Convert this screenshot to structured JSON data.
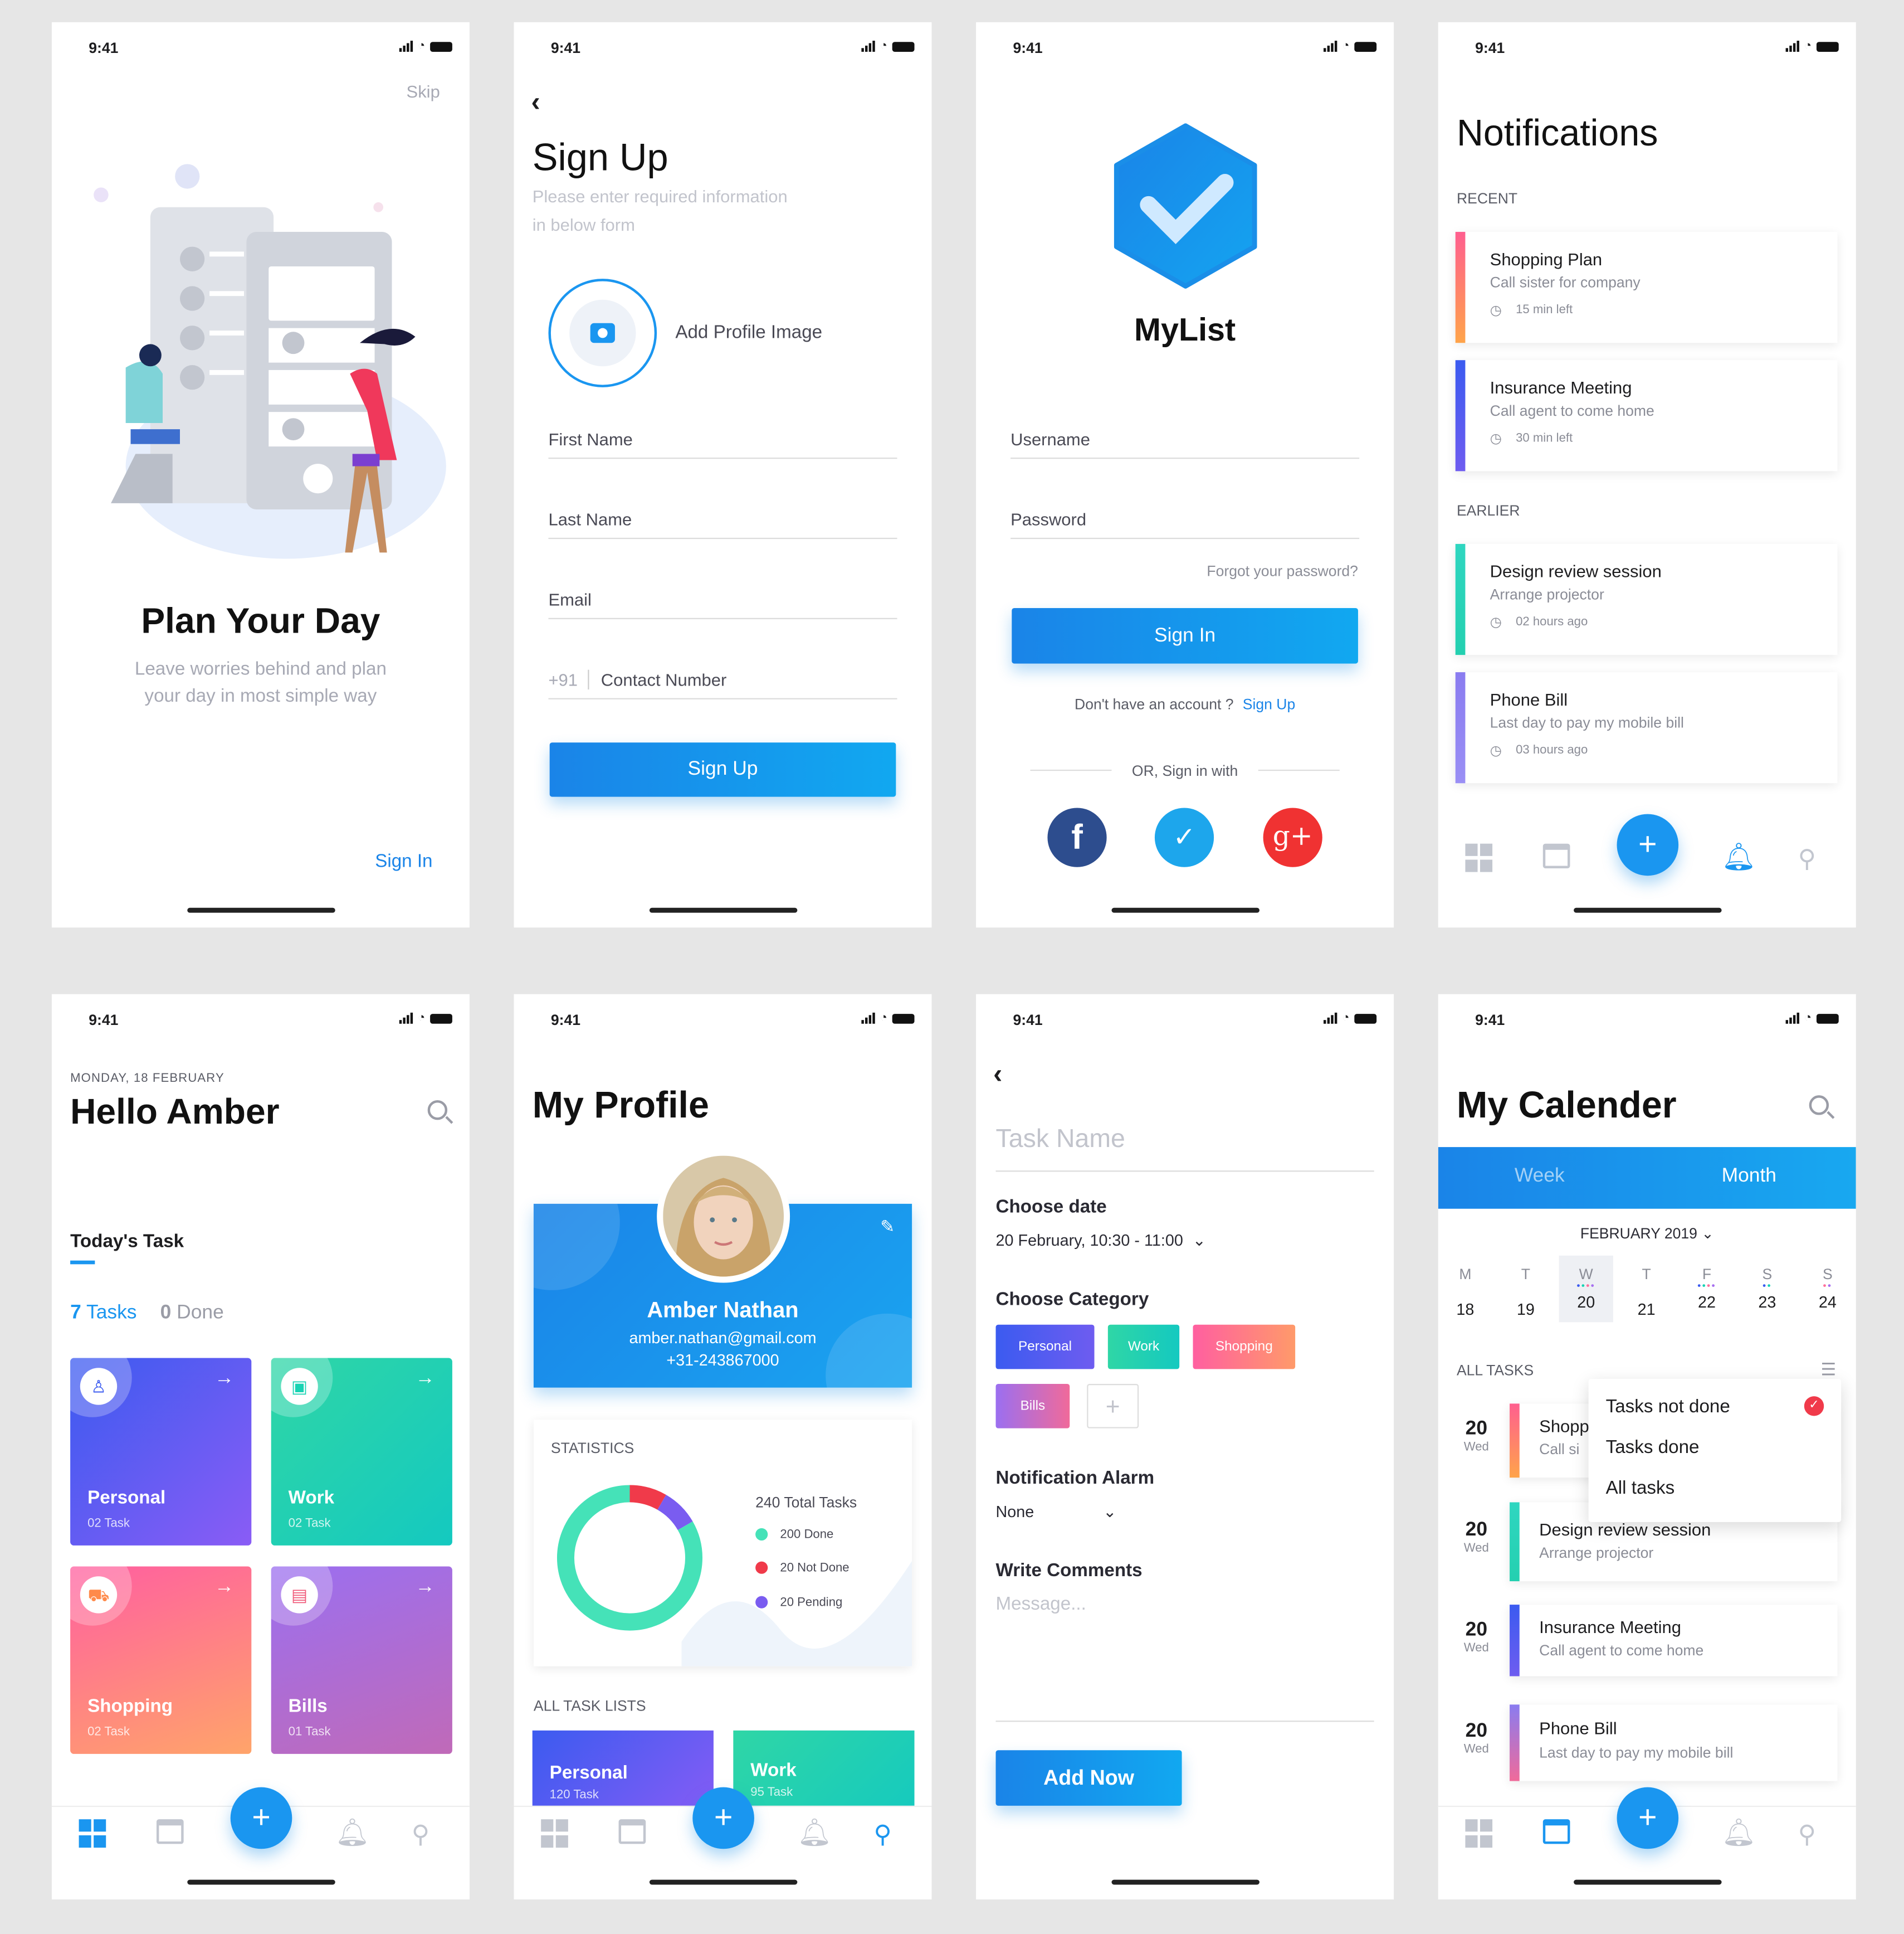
{
  "status": {
    "time": "9:41"
  },
  "onboard": {
    "skip": "Skip",
    "title": "Plan Your Day",
    "subtitle1": "Leave worries behind and plan",
    "subtitle2": "your day in most simple way",
    "signin": "Sign In"
  },
  "signup": {
    "title": "Sign Up",
    "sub1": "Please enter required information",
    "sub2": "in below form",
    "add_image": "Add Profile Image",
    "first_name": "First Name",
    "last_name": "Last Name",
    "email": "Email",
    "code": "+91",
    "contact": "Contact Number",
    "button": "Sign Up"
  },
  "login": {
    "app_name": "MyList",
    "username": "Username",
    "password": "Password",
    "forgot": "Forgot your password?",
    "button": "Sign In",
    "no_account": "Don't have an account ?",
    "signup_link": "Sign Up",
    "or": "OR, Sign in with"
  },
  "notifications": {
    "title": "Notifications",
    "recent": "RECENT",
    "earlier": "EARLIER",
    "items": [
      {
        "title": "Shopping Plan",
        "desc": "Call sister for company",
        "time": "15 min left",
        "color1": "#ff5f8f",
        "color2": "#ffa44a"
      },
      {
        "title": "Insurance Meeting",
        "desc": "Call agent to come home",
        "time": "30 min left",
        "color1": "#3b5bf0",
        "color2": "#6e5cf0"
      },
      {
        "title": "Design review session",
        "desc": "Arrange projector",
        "time": "02 hours ago",
        "color1": "#2fd6c0",
        "color2": "#24d0b0"
      },
      {
        "title": "Phone Bill",
        "desc": "Last day to pay my mobile bill",
        "time": "03 hours ago",
        "color1": "#8a7cf0",
        "color2": "#9a8ff5"
      }
    ]
  },
  "home": {
    "date": "MONDAY, 18 FEBRUARY",
    "greeting": "Hello Amber",
    "today": "Today's Task",
    "tasks_count": "7",
    "tasks_label": "Tasks",
    "done_count": "0",
    "done_label": "Done",
    "cats": [
      {
        "name": "Personal",
        "sub": "02 Task"
      },
      {
        "name": "Work",
        "sub": "02 Task"
      },
      {
        "name": "Shopping",
        "sub": "02 Task"
      },
      {
        "name": "Bills",
        "sub": "01 Task"
      }
    ]
  },
  "profile": {
    "title": "My Profile",
    "name": "Amber Nathan",
    "email": "amber.nathan@gmail.com",
    "phone": "+31-243867000",
    "stats": "STATISTICS",
    "total": "240 Total Tasks",
    "done": "200 Done",
    "not_done": "20 Not Done",
    "pending": "20 Pending",
    "lists": "ALL TASK LISTS",
    "l1": "Personal",
    "l1s": "120 Task",
    "l2": "Work",
    "l2s": "95 Task",
    "chart": {
      "done": 200,
      "not_done": 20,
      "pending": 20
    }
  },
  "addtask": {
    "placeholder": "Task Name",
    "choose_date": "Choose date",
    "date_value": "20 February, 10:30 - 11:00",
    "choose_cat": "Choose Category",
    "chips": [
      "Personal",
      "Work",
      "Shopping",
      "Bills"
    ],
    "alarm": "Notification Alarm",
    "alarm_value": "None",
    "comments": "Write Comments",
    "message": "Message...",
    "button": "Add Now"
  },
  "calendar": {
    "title": "My Calender",
    "week": "Week",
    "month": "Month",
    "month_label": "FEBRUARY 2019",
    "days": [
      {
        "l": "M",
        "n": "18"
      },
      {
        "l": "T",
        "n": "19"
      },
      {
        "l": "W",
        "n": "20"
      },
      {
        "l": "T",
        "n": "21"
      },
      {
        "l": "F",
        "n": "22"
      },
      {
        "l": "S",
        "n": "23"
      },
      {
        "l": "S",
        "n": "24"
      }
    ],
    "all_tasks": "ALL TASKS",
    "menu": [
      "Tasks not done",
      "Tasks done",
      "All tasks"
    ],
    "items": [
      {
        "day": "20",
        "wd": "Wed",
        "title": "Shopp",
        "desc": "Call si"
      },
      {
        "day": "20",
        "wd": "Wed",
        "title": "Design review session",
        "desc": "Arrange projector"
      },
      {
        "day": "20",
        "wd": "Wed",
        "title": "Insurance Meeting",
        "desc": "Call agent to come home"
      },
      {
        "day": "20",
        "wd": "Wed",
        "title": "Phone Bill",
        "desc": "Last day to pay my mobile bill"
      }
    ]
  },
  "colors": {
    "accent": "#1a96f0",
    "personal": "#5b5cf0",
    "work": "#18d3b3",
    "shopping": "#ff6f9b",
    "bills": "#a76ff0"
  }
}
